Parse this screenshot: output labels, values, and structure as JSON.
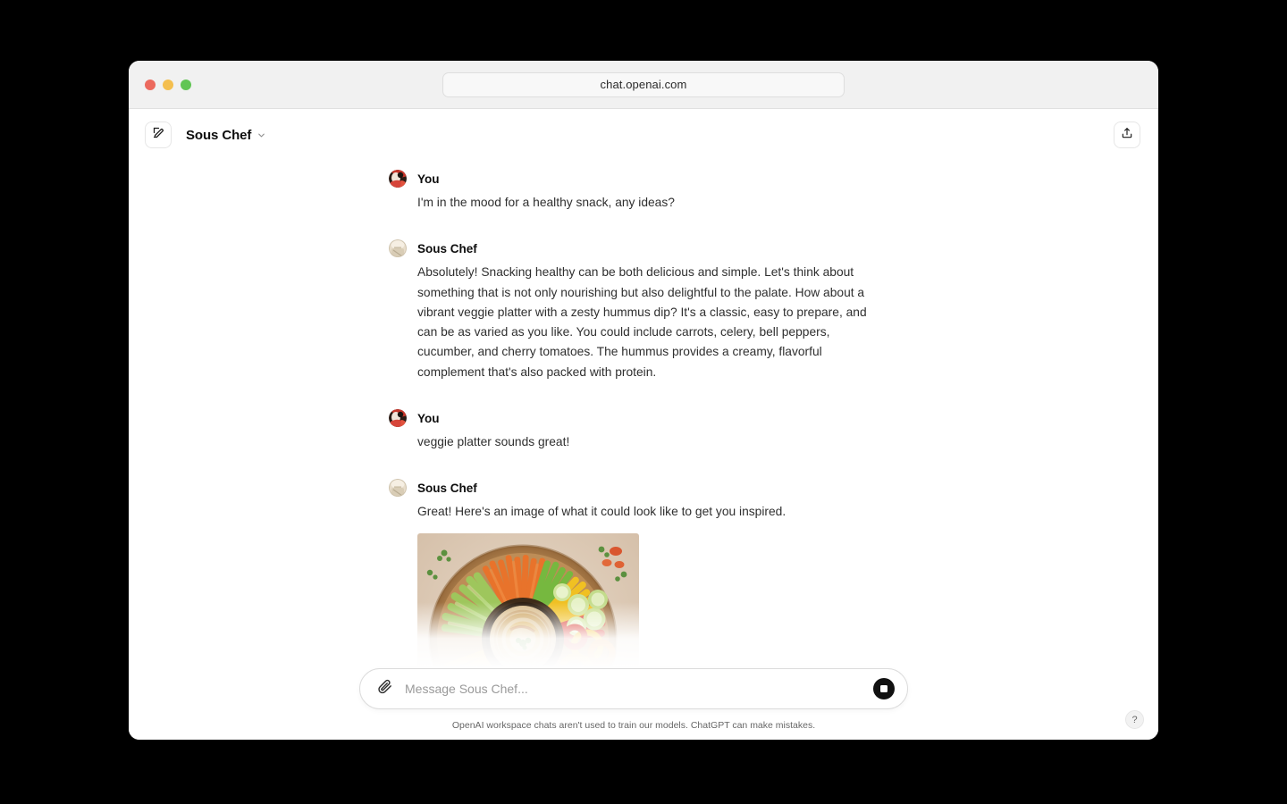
{
  "browser": {
    "url": "chat.openai.com",
    "traffic_lights": [
      {
        "name": "close",
        "color": "#ec6a5e"
      },
      {
        "name": "minimize",
        "color": "#f4bf4f"
      },
      {
        "name": "maximize",
        "color": "#61c554"
      }
    ]
  },
  "header": {
    "new_chat_icon": "compose-pencil-square-icon",
    "title": "Sous Chef",
    "chevron_icon": "chevron-down-icon",
    "share_icon": "share-export-icon"
  },
  "conversation": {
    "messages": [
      {
        "author": "You",
        "avatar": "user-avatar",
        "text": "I'm in the mood for a healthy snack, any ideas?",
        "has_image": false
      },
      {
        "author": "Sous Chef",
        "avatar": "sous-chef-avatar",
        "text": "Absolutely! Snacking healthy can be both delicious and simple. Let's think about something that is not only nourishing but also delightful to the palate. How about a vibrant veggie platter with a zesty hummus dip? It's a classic, easy to prepare, and can be as varied as you like. You could include carrots, celery, bell peppers, cucumber, and cherry tomatoes. The hummus provides a creamy, flavorful complement that's also packed with protein.",
        "has_image": false
      },
      {
        "author": "You",
        "avatar": "user-avatar",
        "text": "veggie platter sounds great!",
        "has_image": false
      },
      {
        "author": "Sous Chef",
        "avatar": "sous-chef-avatar",
        "text": "Great! Here's an image of what it could look like to get you inspired.",
        "has_image": true,
        "image_alt": "Round wooden veggie platter arranged radially with carrot sticks, celery, yellow and orange pepper strips, cucumber slices, red and yellow bell pepper rings, and a central bowl of hummus drizzled with olive oil and paprika, garnished with parsley"
      }
    ]
  },
  "composer": {
    "attach_icon": "paperclip-icon",
    "placeholder": "Message Sous Chef...",
    "value": "",
    "stop_icon": "stop-generating-icon"
  },
  "footer": {
    "note": "OpenAI workspace chats aren't used to train our models. ChatGPT can make mistakes.",
    "help_label": "?"
  },
  "colors": {
    "page_background": "#000000",
    "window_background": "#ffffff",
    "titlebar": "#f1f1f1",
    "text_primary": "#0d0d0d",
    "text_body": "#2f2f2f",
    "text_muted": "#676767"
  }
}
